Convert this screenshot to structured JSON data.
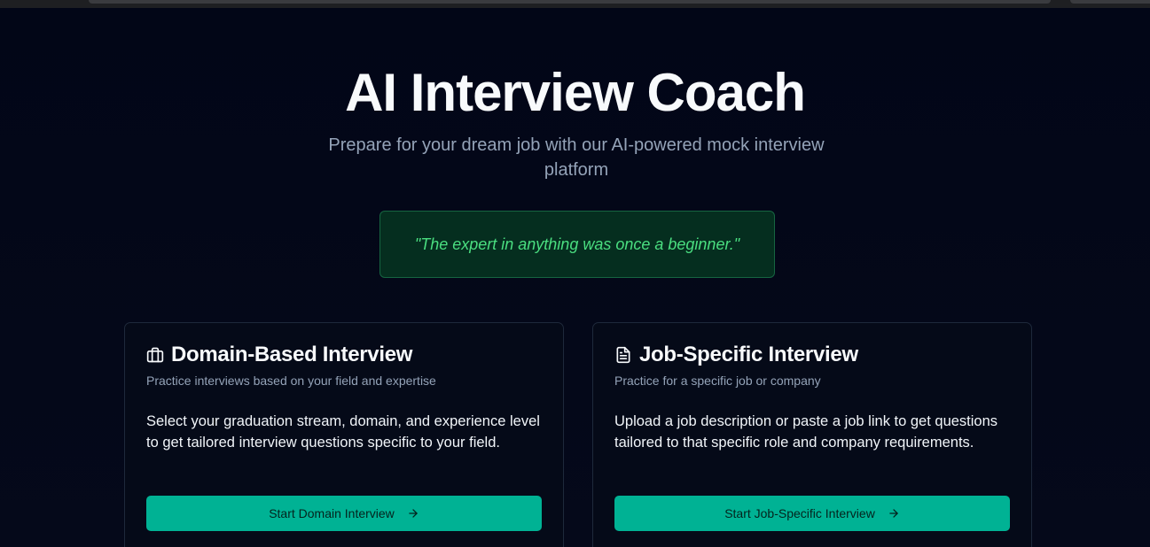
{
  "hero": {
    "title": "AI Interview Coach",
    "subtitle": "Prepare for your dream job with our AI-powered mock interview platform"
  },
  "quote": {
    "text": "\"The expert in anything was once a beginner.\"",
    "color": "#4ade80"
  },
  "cards": [
    {
      "icon": "briefcase-icon",
      "title": "Domain-Based Interview",
      "subtitle": "Practice interviews based on your field and expertise",
      "body": "Select your graduation stream, domain, and experience level to get tailored interview questions specific to your field.",
      "button_label": "Start Domain Interview",
      "button_icon": "arrow-right-icon"
    },
    {
      "icon": "document-icon",
      "title": "Job-Specific Interview",
      "subtitle": "Practice for a specific job or company",
      "body": "Upload a job description or paste a job link to get questions tailored to that specific role and company requirements.",
      "button_label": "Start Job-Specific Interview",
      "button_icon": "arrow-right-icon"
    }
  ],
  "colors": {
    "background": "#020617",
    "accent": "#00b294",
    "card_border": "#1e293b",
    "quote_background": "#052e1f"
  }
}
